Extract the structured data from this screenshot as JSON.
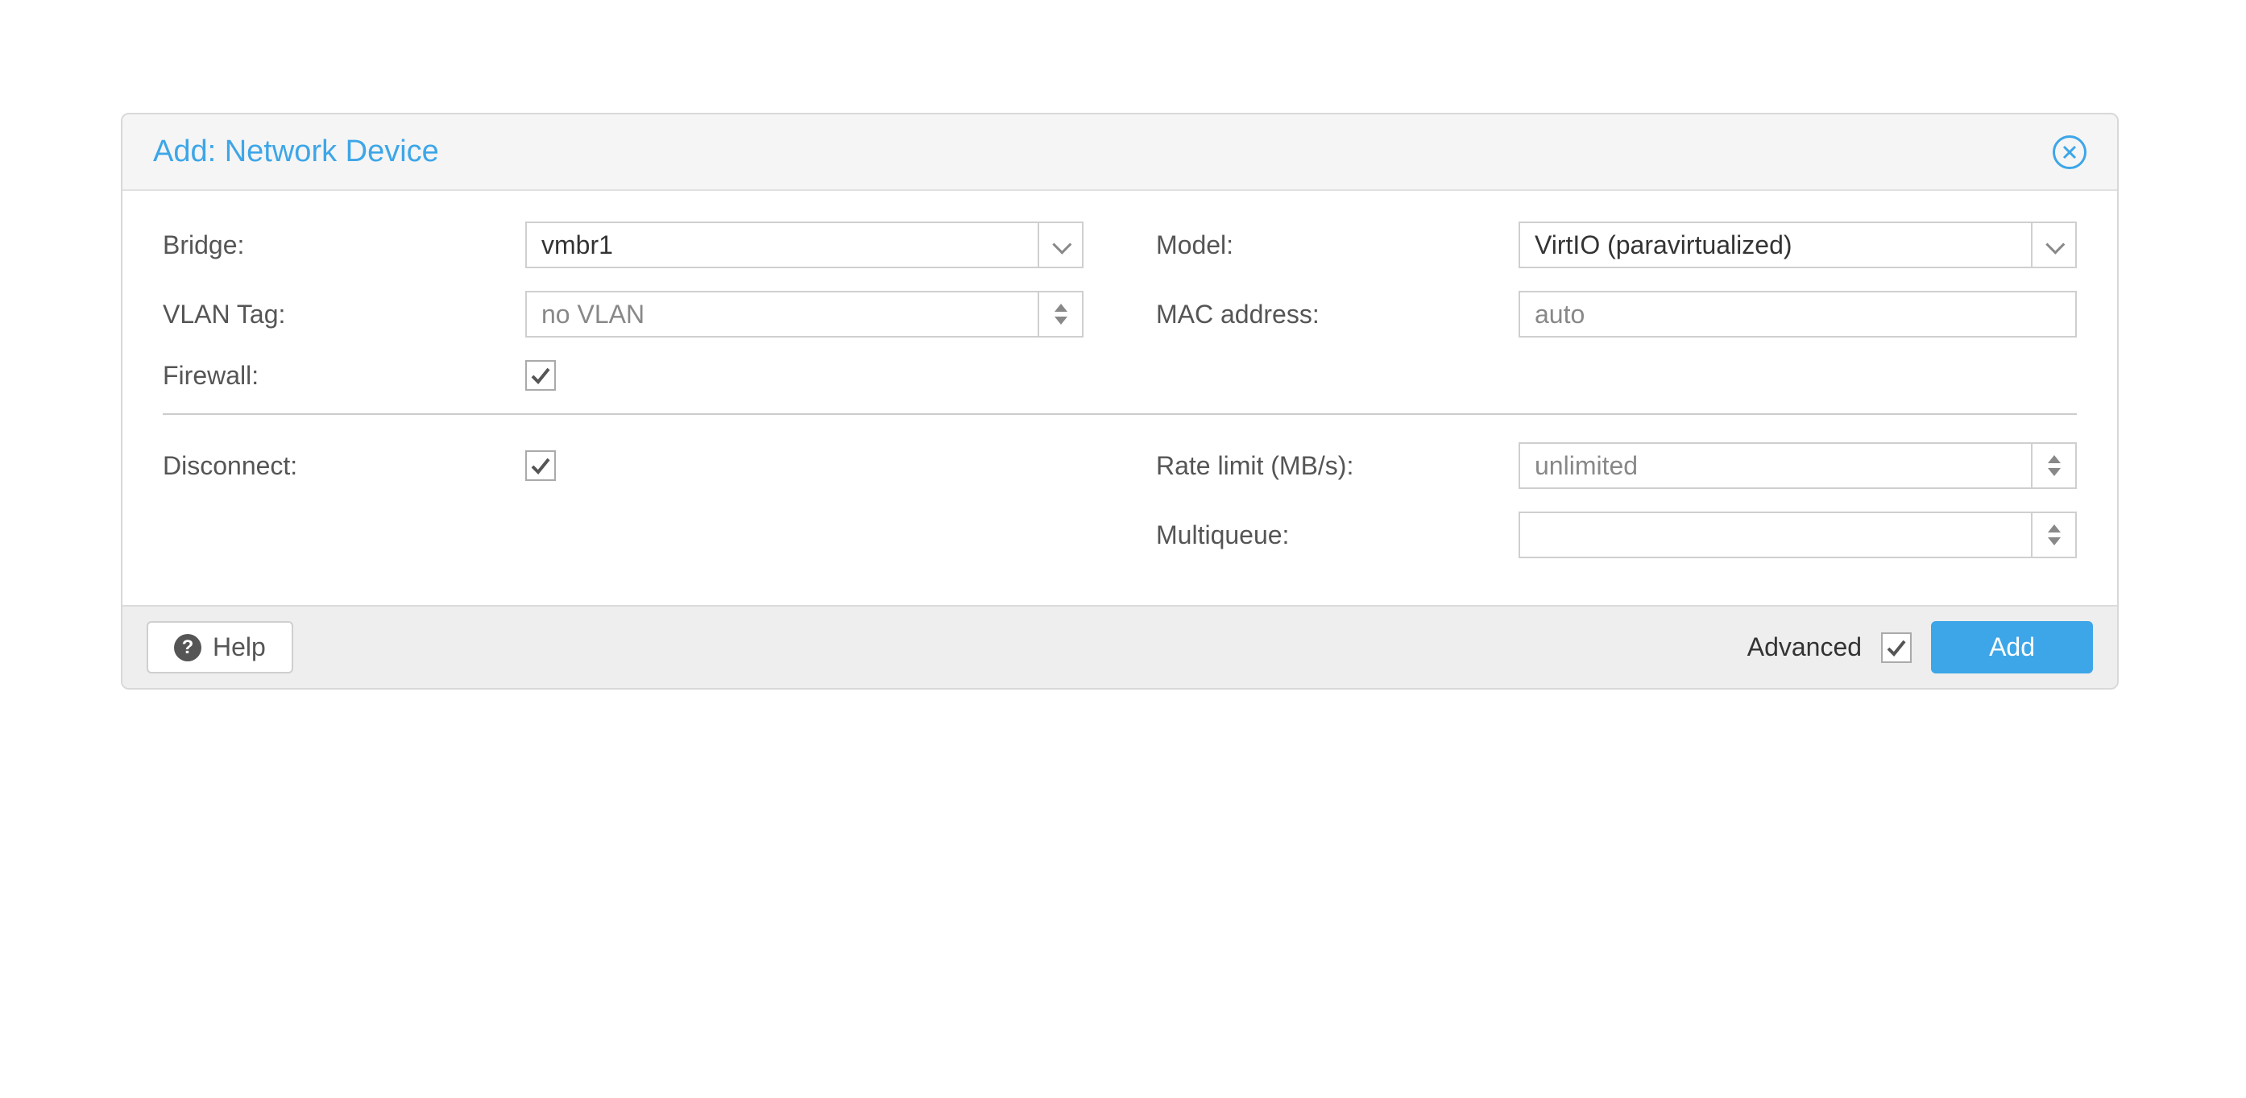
{
  "dialog": {
    "title": "Add: Network Device"
  },
  "fields": {
    "bridge": {
      "label": "Bridge:",
      "value": "vmbr1"
    },
    "vlan": {
      "label": "VLAN Tag:",
      "placeholder": "no VLAN"
    },
    "firewall": {
      "label": "Firewall:"
    },
    "model": {
      "label": "Model:",
      "value": "VirtIO (paravirtualized)"
    },
    "mac": {
      "label": "MAC address:",
      "placeholder": "auto"
    },
    "disconnect": {
      "label": "Disconnect:"
    },
    "rate": {
      "label": "Rate limit (MB/s):",
      "placeholder": "unlimited"
    },
    "multiqueue": {
      "label": "Multiqueue:"
    }
  },
  "footer": {
    "help": "Help",
    "advanced": "Advanced",
    "add": "Add"
  }
}
